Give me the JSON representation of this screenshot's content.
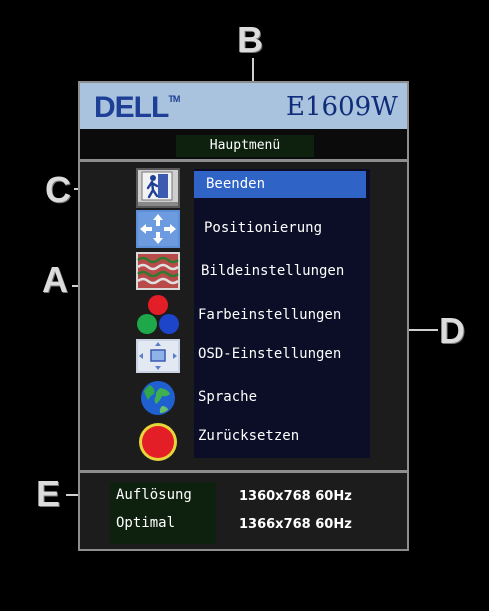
{
  "callouts": {
    "a": "A",
    "b": "B",
    "c": "C",
    "d": "D",
    "e": "E"
  },
  "header": {
    "logo": "DELL",
    "trademark": "TM",
    "model": "E1609W"
  },
  "title": "Hauptmenü",
  "menu": {
    "items": [
      {
        "label": "Beenden",
        "icon": "exit-icon"
      },
      {
        "label": "Positionierung",
        "icon": "position-arrows-icon"
      },
      {
        "label": "Bildeinstellungen",
        "icon": "image-settings-icon"
      },
      {
        "label": "Farbeinstellungen",
        "icon": "color-settings-icon"
      },
      {
        "label": "OSD-Einstellungen",
        "icon": "osd-settings-icon"
      },
      {
        "label": "Sprache",
        "icon": "globe-icon"
      },
      {
        "label": "Zurücksetzen",
        "icon": "reset-icon"
      }
    ],
    "selected_index": 0
  },
  "footer": {
    "resolution_label": "Auflösung",
    "resolution_value": "1360x768 60Hz",
    "optimal_label": "Optimal",
    "optimal_value": "1366x768 60Hz"
  },
  "colors": {
    "header_bg": "#a9c2dd",
    "selection": "#2f63c5",
    "list_bg": "#0b0e26",
    "footer_label_bg": "#0e200e"
  }
}
